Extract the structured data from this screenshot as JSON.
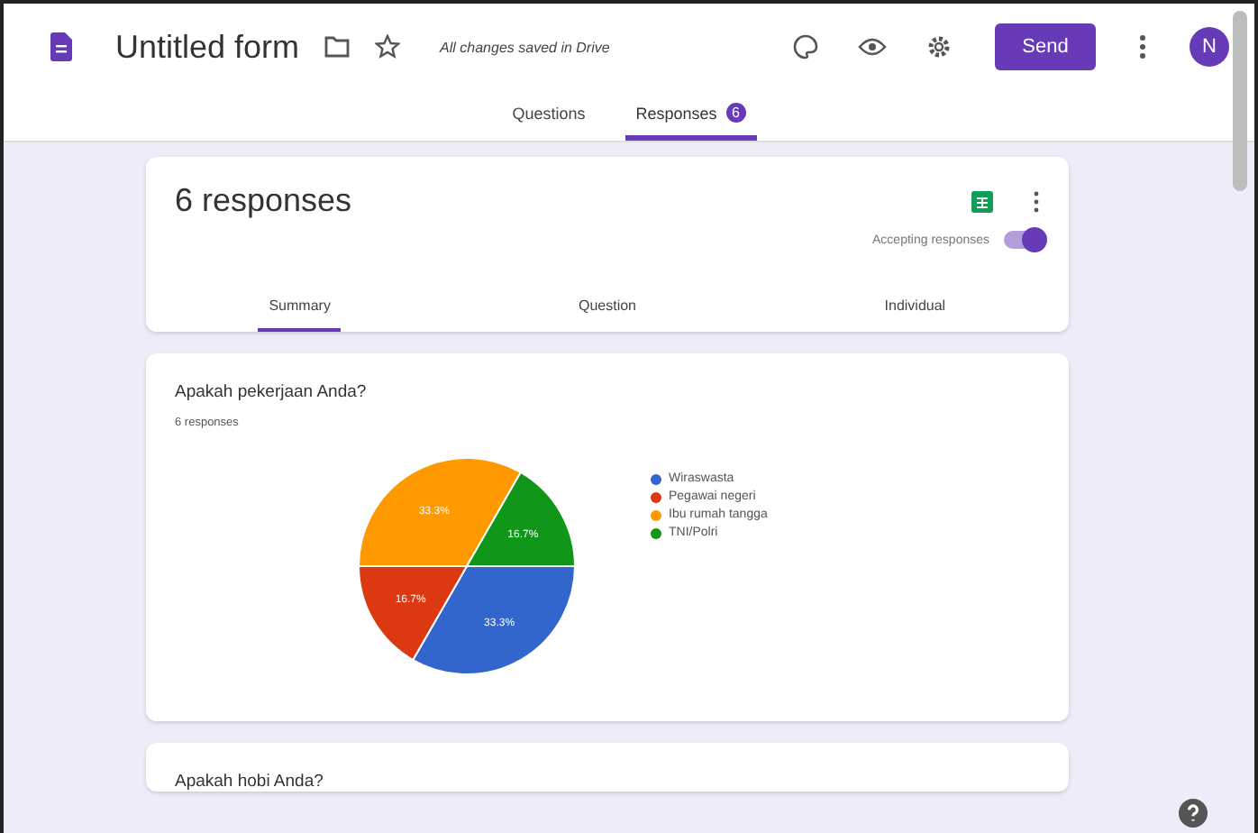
{
  "header": {
    "title": "Untitled form",
    "save_status": "All changes saved in Drive",
    "send_button": "Send",
    "avatar": "N"
  },
  "tabs": [
    {
      "label": "Questions",
      "selected": false
    },
    {
      "label": "Responses",
      "selected": true,
      "badge": "6"
    }
  ],
  "summary_card": {
    "title": "6 responses",
    "accepting_label": "Accepting responses",
    "accepting": true,
    "views": [
      {
        "label": "Summary",
        "selected": true
      },
      {
        "label": "Question",
        "selected": false
      },
      {
        "label": "Individual",
        "selected": false
      }
    ]
  },
  "questions": [
    {
      "title": "Apakah pekerjaan Anda?",
      "count": "6 responses",
      "chart_data": {
        "type": "pie",
        "categories": [
          "Wiraswasta",
          "Pegawai negeri",
          "Ibu rumah tangga",
          "TNI/Polri"
        ],
        "legend": "right",
        "series": [
          {
            "colors": [
              "#3366cc",
              "#dc3912",
              "#ff9900",
              "#109618"
            ],
            "values": [
              33.3,
              16.7,
              33.3,
              16.7
            ]
          }
        ],
        "value_labels": [
          "33.3%",
          "16.7%",
          "33.3%",
          "16.7%"
        ]
      }
    },
    {
      "title": "Apakah hobi Anda?"
    }
  ]
}
